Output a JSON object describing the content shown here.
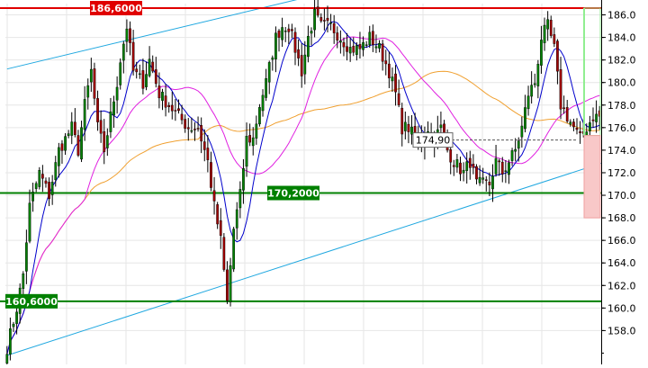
{
  "chart_data": {
    "type": "candlestick",
    "y_axis": {
      "min": 155,
      "max": 187,
      "ticks": [
        158,
        160,
        162,
        164,
        166,
        168,
        170,
        172,
        174,
        176,
        178,
        180,
        182,
        184,
        186
      ],
      "tick_decimals": 1,
      "side": "right"
    },
    "grid": true,
    "colors": {
      "up": "#008000",
      "down": "#a00000",
      "wick": "#000000",
      "sma_fast": "#0000cc",
      "sma_mid": "#e020e0",
      "sma_slow": "#f0a030",
      "channel": "#20a8e0",
      "resistance": "#ff0000",
      "support": "#008000",
      "target_up": "#90ee90",
      "target_down": "#f0a0a0"
    },
    "levels": [
      {
        "name": "resistance",
        "value": 186.6,
        "label": "186,6000",
        "color": "#e00000",
        "label_side": "left"
      },
      {
        "name": "middle-support",
        "value": 170.2,
        "label": "170,2000",
        "color": "#008000",
        "label_side": "middle"
      },
      {
        "name": "major-support",
        "value": 160.6,
        "label": "160,6000",
        "color": "#008000",
        "label_side": "left"
      }
    ],
    "annotations": [
      {
        "name": "price-callout",
        "value": 174.9,
        "label": "174,90"
      }
    ],
    "channel": {
      "upper": [
        {
          "i": 0,
          "value": 181.2
        },
        {
          "i": 112,
          "value": 188.9
        }
      ],
      "lower": [
        {
          "i": 0,
          "value": 155.8
        },
        {
          "i": 196,
          "value": 174.0
        }
      ]
    },
    "target_zone": {
      "start": 175.3,
      "up_to": 186.6,
      "down_to": 168.0
    },
    "waypoints": [
      [
        0,
        156.5
      ],
      [
        3,
        160
      ],
      [
        5,
        163
      ],
      [
        7,
        169
      ],
      [
        10,
        172
      ],
      [
        13,
        170
      ],
      [
        16,
        174
      ],
      [
        20,
        176
      ],
      [
        22,
        174
      ],
      [
        24,
        178
      ],
      [
        26,
        181
      ],
      [
        28,
        176
      ],
      [
        30,
        174
      ],
      [
        32,
        177
      ],
      [
        34,
        180
      ],
      [
        35,
        182
      ],
      [
        37,
        185
      ],
      [
        39,
        181
      ],
      [
        42,
        180
      ],
      [
        44,
        182
      ],
      [
        47,
        179
      ],
      [
        50,
        178
      ],
      [
        53,
        177
      ],
      [
        56,
        176
      ],
      [
        59,
        176
      ],
      [
        62,
        173
      ],
      [
        64,
        169
      ],
      [
        66,
        166
      ],
      [
        68,
        160.5
      ],
      [
        70,
        167
      ],
      [
        72,
        170
      ],
      [
        74,
        175
      ],
      [
        76,
        175
      ],
      [
        78,
        178
      ],
      [
        80,
        180
      ],
      [
        83,
        184
      ],
      [
        85,
        185
      ],
      [
        87,
        185
      ],
      [
        89,
        183
      ],
      [
        91,
        181
      ],
      [
        93,
        184
      ],
      [
        95,
        186
      ],
      [
        97,
        185
      ],
      [
        100,
        185
      ],
      [
        103,
        184
      ],
      [
        106,
        183
      ],
      [
        109,
        183
      ],
      [
        112,
        184
      ],
      [
        115,
        183
      ],
      [
        118,
        181
      ],
      [
        120,
        179
      ],
      [
        122,
        176
      ],
      [
        124,
        176
      ],
      [
        126,
        175
      ],
      [
        128,
        175
      ],
      [
        130,
        176
      ],
      [
        132,
        175
      ],
      [
        134,
        176
      ],
      [
        136,
        174
      ],
      [
        138,
        173
      ],
      [
        141,
        172
      ],
      [
        143,
        173
      ],
      [
        145,
        171
      ],
      [
        147,
        171
      ],
      [
        149,
        171
      ],
      [
        151,
        173
      ],
      [
        153,
        172
      ],
      [
        155,
        173
      ],
      [
        157,
        174
      ],
      [
        159,
        176
      ],
      [
        161,
        179
      ],
      [
        163,
        180
      ],
      [
        165,
        184
      ],
      [
        167,
        185
      ],
      [
        169,
        183
      ],
      [
        171,
        178
      ],
      [
        173,
        177
      ],
      [
        175,
        176
      ],
      [
        177,
        175
      ],
      [
        179,
        176
      ],
      [
        181,
        177
      ],
      [
        183,
        177
      ]
    ]
  }
}
